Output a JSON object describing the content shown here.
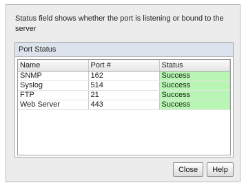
{
  "description": "Status field shows whether the port is listening or bound to the server",
  "group": {
    "title": "Port Status",
    "columns": [
      "Name",
      "Port #",
      "Status"
    ],
    "rows": [
      {
        "name": "SNMP",
        "port": "162",
        "status": "Success"
      },
      {
        "name": "Syslog",
        "port": "514",
        "status": "Success"
      },
      {
        "name": "FTP",
        "port": "21",
        "status": "Success"
      },
      {
        "name": "Web Server",
        "port": "443",
        "status": "Success"
      }
    ]
  },
  "buttons": {
    "close": "Close",
    "help": "Help"
  },
  "colors": {
    "success": "#b9f5b4",
    "header": "#dde3ec"
  }
}
